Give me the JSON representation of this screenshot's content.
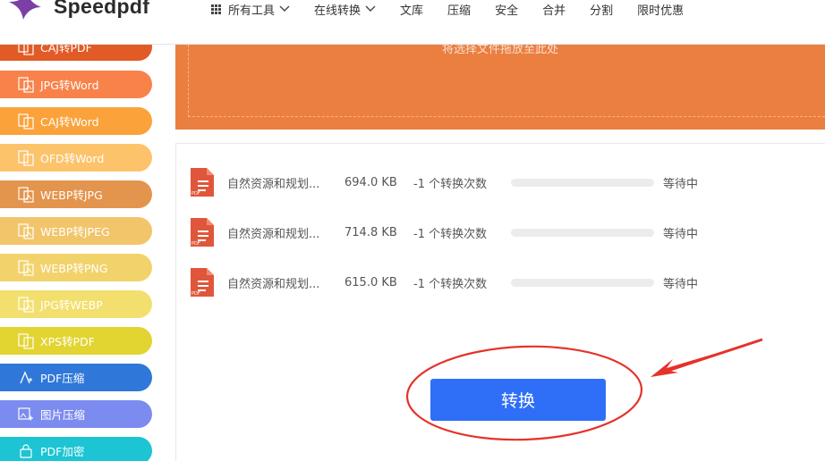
{
  "header": {
    "brand": "Speedpdf",
    "brand_color": "#7b3fa8",
    "nav": [
      {
        "label": "所有工具",
        "icon": "grid-icon",
        "dropdown": true
      },
      {
        "label": "在线转换",
        "dropdown": true
      },
      {
        "label": "文库"
      },
      {
        "label": "压缩"
      },
      {
        "label": "安全"
      },
      {
        "label": "合并"
      },
      {
        "label": "分割"
      },
      {
        "label": "限时优惠"
      }
    ]
  },
  "sidebar": {
    "items": [
      {
        "label": "CAJ转PDF",
        "color": "#e25a25"
      },
      {
        "label": "JPG转Word",
        "color": "#f9824a"
      },
      {
        "label": "CAJ转Word",
        "color": "#fba23a"
      },
      {
        "label": "OFD转Word",
        "color": "#fdc36b"
      },
      {
        "label": "WEBP转JPG",
        "color": "#e3944d"
      },
      {
        "label": "WEBP转JPEG",
        "color": "#f2c56b"
      },
      {
        "label": "WEBP转PNG",
        "color": "#f2d36b"
      },
      {
        "label": "JPG转WEBP",
        "color": "#f3df6d"
      },
      {
        "label": "XPS转PDF",
        "color": "#e2d431"
      },
      {
        "label": "PDF压缩",
        "color": "#2f78d9"
      },
      {
        "label": "图片压缩",
        "color": "#7c8bef"
      },
      {
        "label": "PDF加密",
        "color": "#1cc4d4"
      }
    ]
  },
  "upload": {
    "hint": "将选择文件拖放至此处",
    "color": "#eb7f3f"
  },
  "files": [
    {
      "name": "自然资源和规划...",
      "size": "694.0 KB",
      "count": "-1 个转换次数",
      "progress": 0,
      "status": "等待中"
    },
    {
      "name": "自然资源和规划...",
      "size": "714.8 KB",
      "count": "-1 个转换次数",
      "progress": 0,
      "status": "等待中"
    },
    {
      "name": "自然资源和规划...",
      "size": "615.0 KB",
      "count": "-1 个转换次数",
      "progress": 0,
      "status": "等待中"
    }
  ],
  "convert": {
    "label": "转换",
    "color": "#2f6ff7"
  },
  "annotation_color": "#e5322b"
}
